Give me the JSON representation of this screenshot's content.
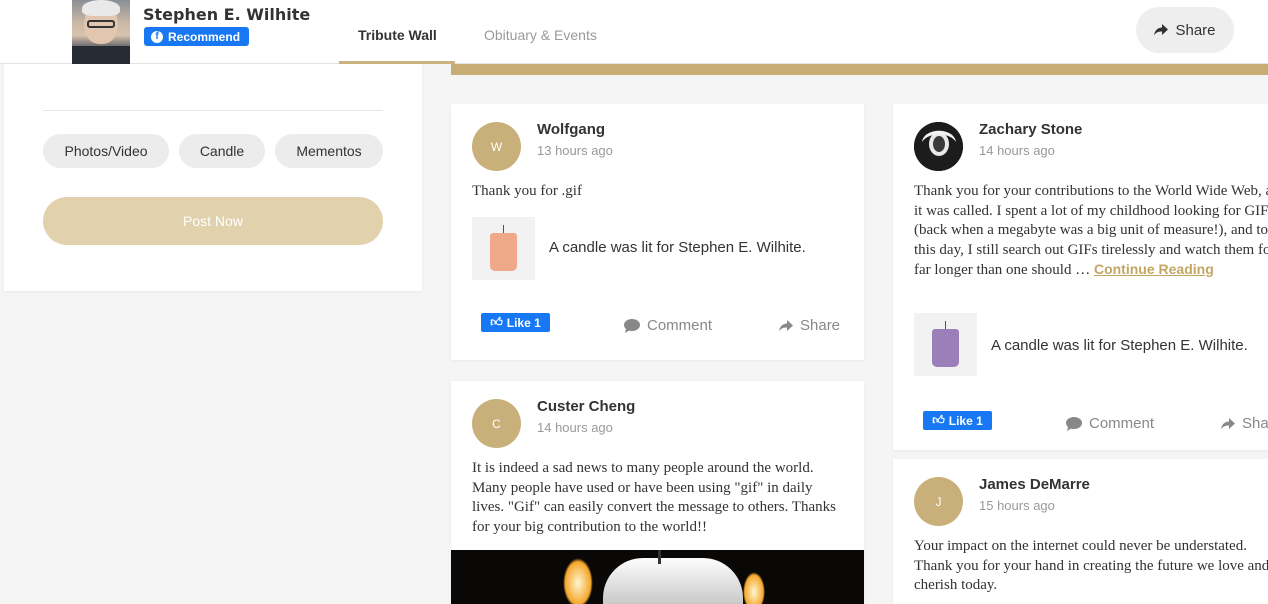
{
  "header": {
    "name": "Stephen E. Wilhite",
    "recommend_label": "Recommend",
    "tabs": [
      {
        "label": "Tribute Wall",
        "active": true
      },
      {
        "label": "Obituary & Events",
        "active": false
      }
    ],
    "share_label": "Share"
  },
  "composer": {
    "pills": [
      "Photos/Video",
      "Candle",
      "Mementos"
    ],
    "post_label": "Post Now"
  },
  "posts": [
    {
      "initial": "W",
      "author": "Wolfgang",
      "time": "13 hours ago",
      "message": "Thank you for .gif",
      "candle_text": "A candle was lit for Stephen E. Wilhite.",
      "candle_color": "#f0a88a",
      "like_label": "Like 1",
      "comment_label": "Comment",
      "share_label": "Share"
    },
    {
      "initial": "C",
      "author": "Custer Cheng",
      "time": "14 hours ago",
      "message": "It is indeed a sad news to many people around the world. Many people have used or have been using \"gif\" in daily lives. \"Gif\" can easily convert the message to others. Thanks for your big contribution to the world!!"
    },
    {
      "author": "Zachary Stone",
      "time": "14 hours ago",
      "message": "Thank you for your contributions to the World Wide Web, as it was called. I spent a lot of my childhood looking for GIFs (back when a megabyte was a big unit of measure!), and to this day, I still search out GIFs tirelessly and watch them for far longer than one should",
      "ellipsis": "…",
      "continue_label": "Continue Reading",
      "candle_text": "A candle was lit for Stephen E. Wilhite.",
      "candle_color": "#9b7fb8",
      "like_label": "Like 1",
      "comment_label": "Comment",
      "share_label": "Share"
    },
    {
      "initial": "J",
      "author": "James DeMarre",
      "time": "15 hours ago",
      "message": "Your impact on the internet could never be understated. Thank you for your hand in creating the future we love and cherish today."
    }
  ],
  "colors": {
    "accent_gold": "#c7ad73",
    "facebook_blue": "#1877f2"
  }
}
